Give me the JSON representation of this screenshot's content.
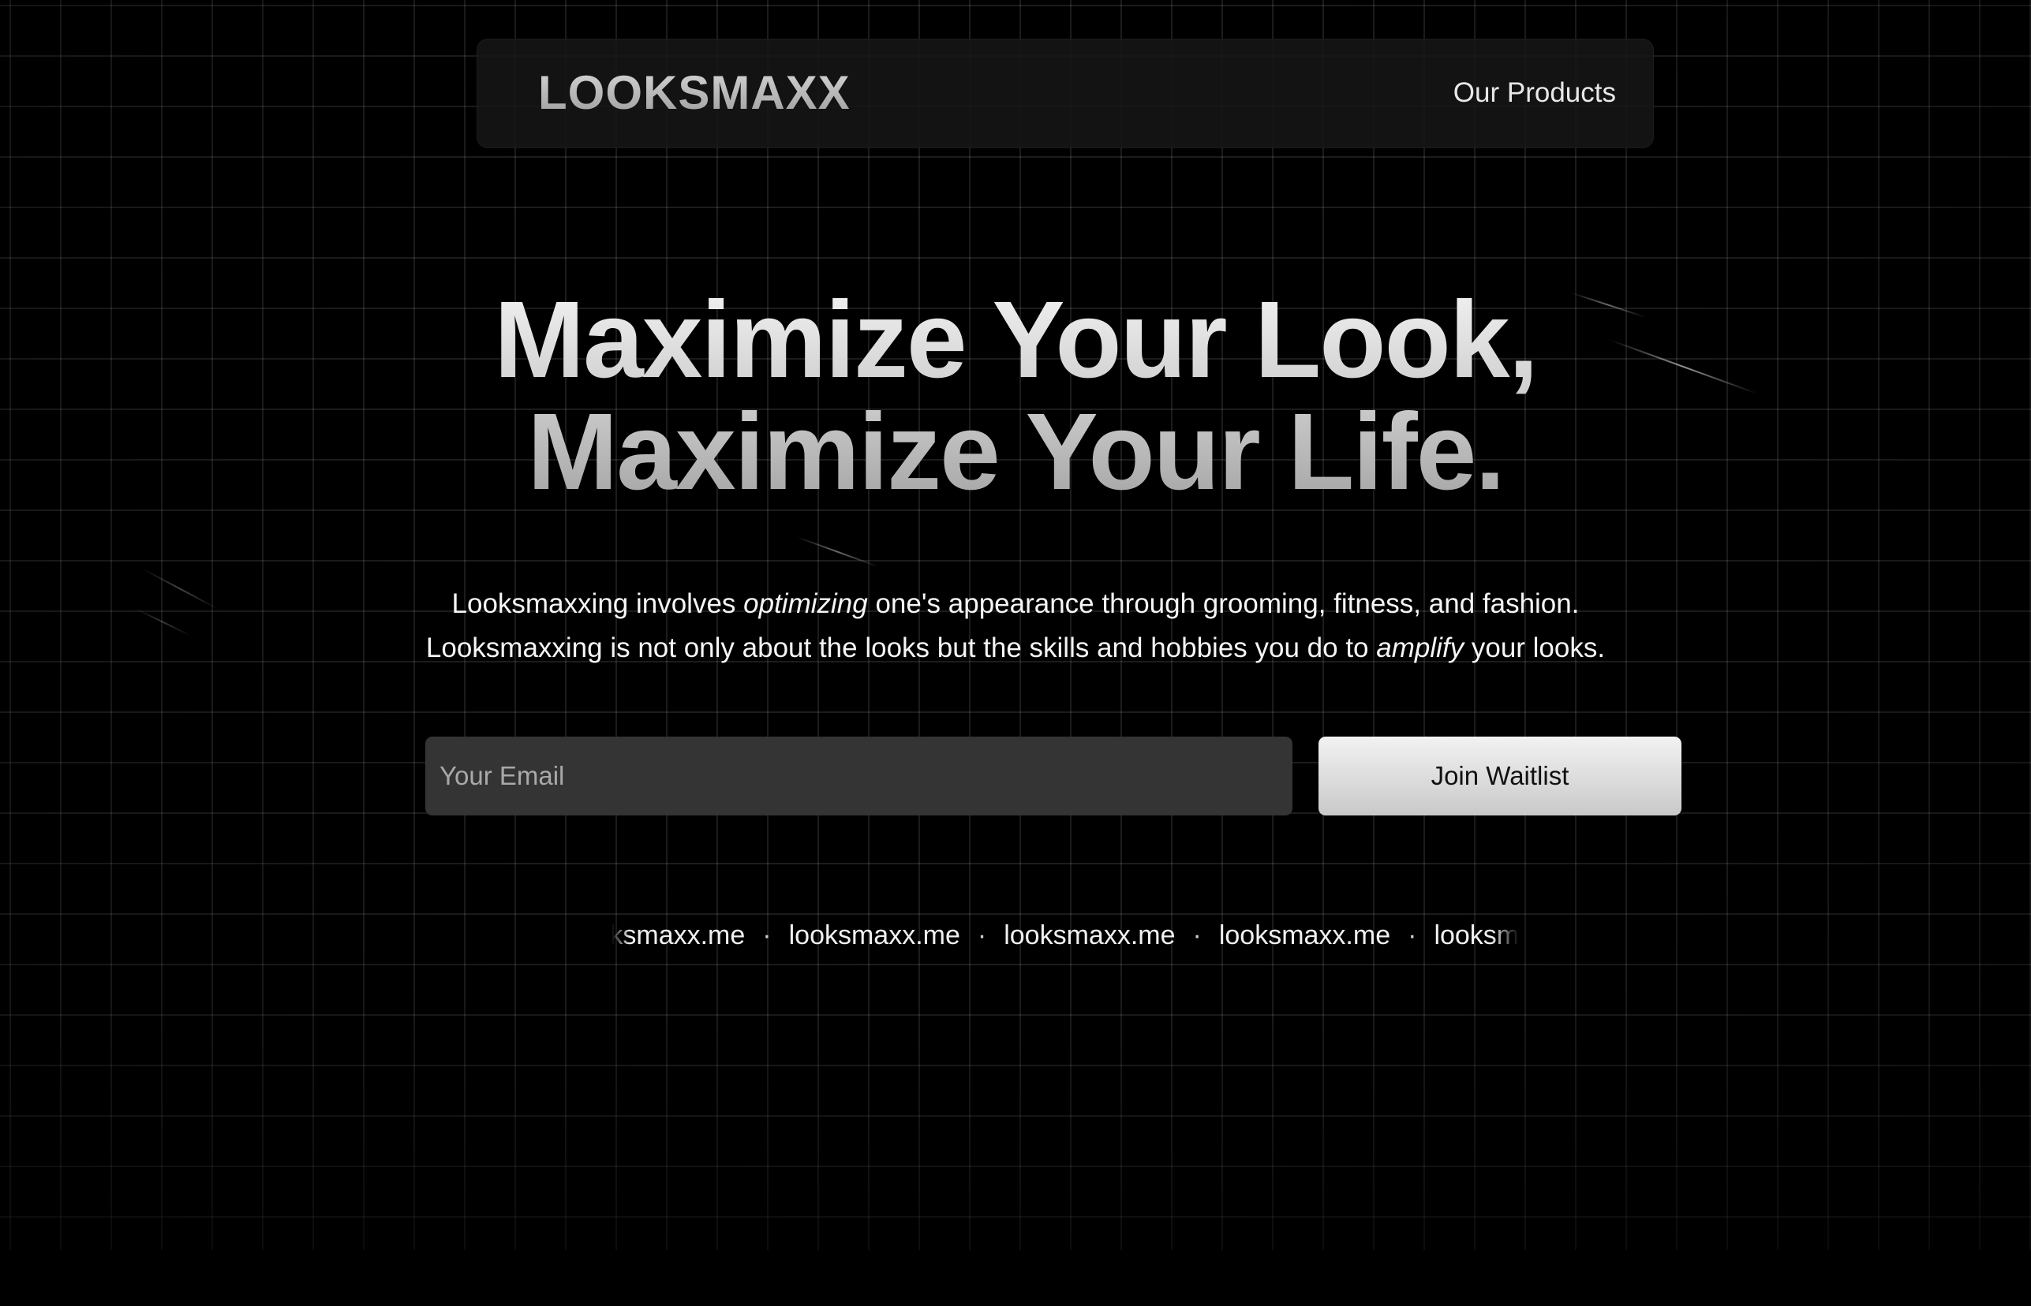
{
  "nav": {
    "logo": "LOOKSMAXX",
    "products_link": "Our Products"
  },
  "hero": {
    "headline_line1": "Maximize Your Look,",
    "headline_line2": "Maximize Your Life.",
    "subtext_line1_a": "Looksmaxxing involves ",
    "subtext_line1_em": "optimizing",
    "subtext_line1_b": " one's appearance through grooming, fitness, and fashion.",
    "subtext_line2_a": "Looksmaxxing is not only about the looks but the skills and hobbies you do to ",
    "subtext_line2_em": "amplify",
    "subtext_line2_b": " your looks."
  },
  "form": {
    "email_placeholder": "Your Email",
    "email_value": "",
    "join_button": "Join Waitlist"
  },
  "marquee": {
    "items": [
      "looksmaxx.me",
      "looksmaxx.me",
      "looksmaxx.me",
      "looksmaxx.me",
      "looksmaxx.me"
    ],
    "separator": "·"
  },
  "colors": {
    "background": "#000000",
    "input_bg": "#343434",
    "button_bg": "#e6e6e6",
    "text": "#f5f5f5"
  }
}
